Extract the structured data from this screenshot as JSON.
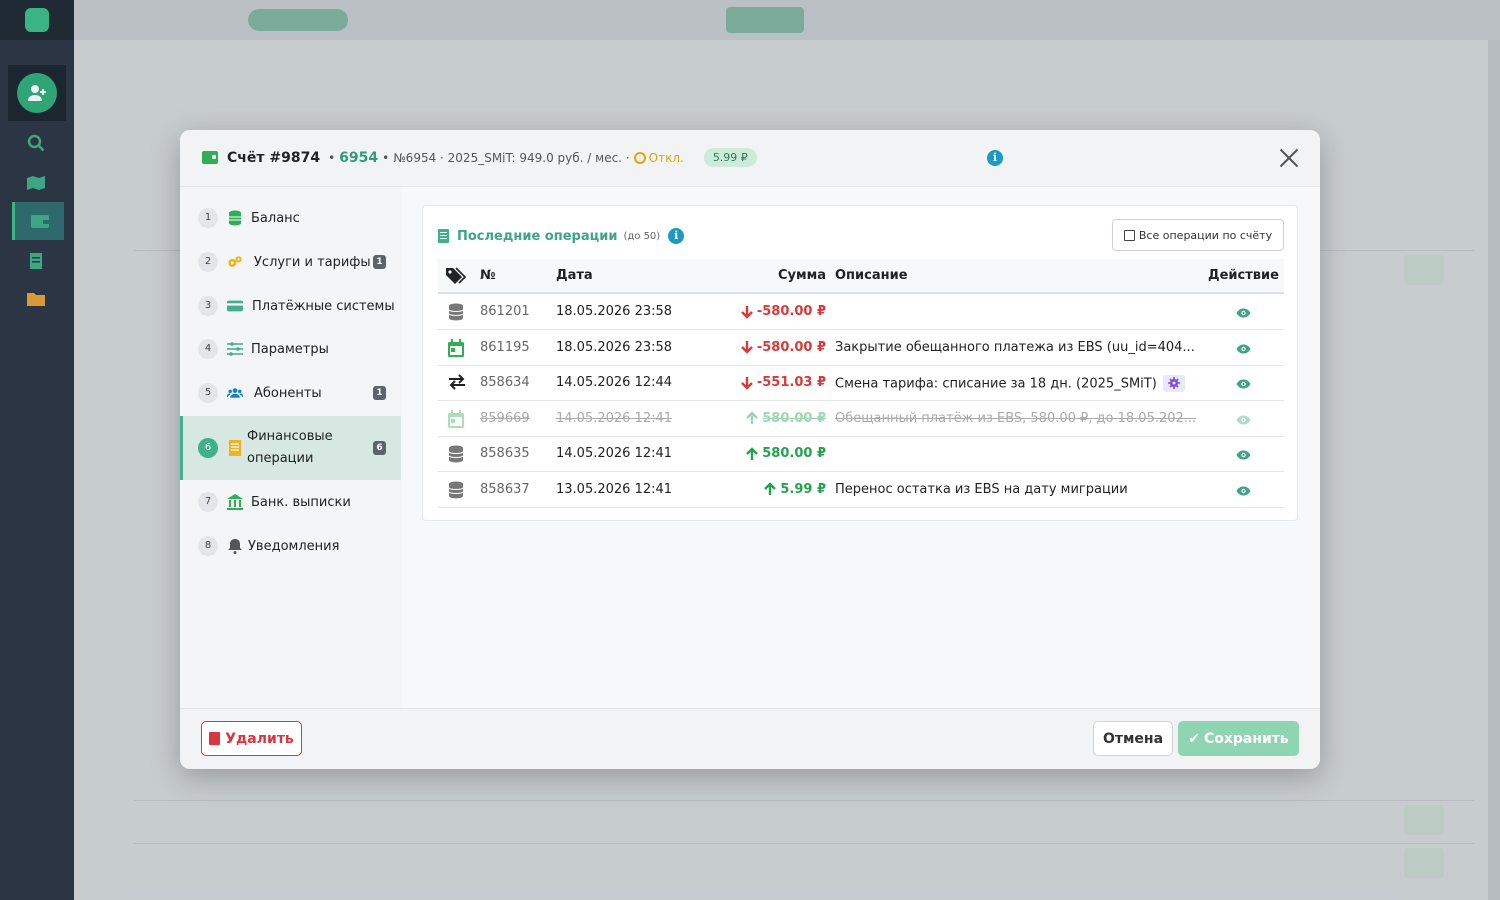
{
  "modal": {
    "header": {
      "account_title": "Счёт #9874",
      "separator": "•",
      "account_number": "6954",
      "separator2": "•",
      "account_details": "№6954 · 2025_SMiT: 949.0 руб. / мес. ·",
      "status": "Откл.",
      "balance_badge": "5.99 ₽"
    },
    "nav": {
      "items": [
        {
          "num": "1",
          "label": "Баланс",
          "icon": "coins-icon"
        },
        {
          "num": "2",
          "label": "Услуги и тарифы",
          "icon": "gears-icon",
          "count": "1"
        },
        {
          "num": "3",
          "label": "Платёжные системы",
          "icon": "credit-card-icon"
        },
        {
          "num": "4",
          "label": "Параметры",
          "icon": "sliders-icon"
        },
        {
          "num": "5",
          "label": "Абоненты",
          "icon": "users-icon",
          "count": "1"
        },
        {
          "num": "6",
          "label": "Финансовые операции",
          "icon": "receipt-icon",
          "count": "6",
          "active": true
        },
        {
          "num": "7",
          "label": "Банк. выписки",
          "icon": "bank-icon"
        },
        {
          "num": "8",
          "label": "Уведомления",
          "icon": "bell-icon"
        }
      ]
    },
    "card": {
      "title": "Последние операции",
      "subtitle": "(до 50)",
      "all_ops_button": "Все операции по счёту",
      "columns": {
        "no": "№",
        "date": "Дата",
        "sum": "Сумма",
        "desc": "Описание",
        "action": "Действие"
      },
      "rows": [
        {
          "icon": "database-icon",
          "no": "861201",
          "date": "18.05.2026 23:58",
          "sum": "-580.00 ₽",
          "dir": "down",
          "desc": "",
          "cancelled": false
        },
        {
          "icon": "calendar-icon",
          "no": "861195",
          "date": "18.05.2026 23:58",
          "sum": "-580.00 ₽",
          "dir": "down",
          "desc": "Закрытие обещанного платежа из EBS (uu_id=404...",
          "cancelled": false
        },
        {
          "icon": "exchange-icon",
          "no": "858634",
          "date": "14.05.2026 12:44",
          "sum": "-551.03 ₽",
          "dir": "down",
          "desc": "Смена тарифа: списание за 18 дн. (2025_SMiT)",
          "gear": true,
          "cancelled": false
        },
        {
          "icon": "calendar-icon",
          "no": "859669",
          "date": "14.05.2026 12:41",
          "sum": "580.00 ₽",
          "dir": "up",
          "desc": "Обещанный платёж из EBS, 580.00 ₽, до 18.05.202...",
          "cancelled": true
        },
        {
          "icon": "database-icon",
          "no": "858635",
          "date": "14.05.2026 12:41",
          "sum": "580.00 ₽",
          "dir": "up",
          "desc": "",
          "cancelled": false
        },
        {
          "icon": "database-icon",
          "no": "858637",
          "date": "13.05.2026 12:41",
          "sum": "5.99 ₽",
          "dir": "up",
          "desc": "Перенос остатка из EBS на дату миграции",
          "cancelled": false
        }
      ]
    },
    "footer": {
      "delete_label": "Удалить",
      "cancel_label": "Отмена",
      "save_label": "Сохранить"
    }
  },
  "colors": {
    "accent": "#3fb08a",
    "negative": "#d63b3b",
    "positive": "#26a150",
    "danger": "#d9363e",
    "sidebar": "#2c3645"
  }
}
